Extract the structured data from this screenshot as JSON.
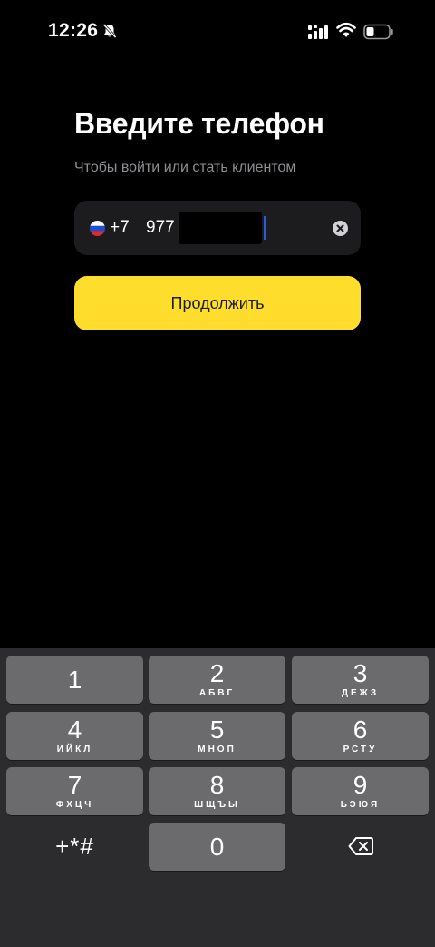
{
  "status_bar": {
    "time": "12:26",
    "icons": [
      "bell-slash-icon",
      "cellular-signal-icon",
      "wifi-icon",
      "battery-icon"
    ]
  },
  "login": {
    "title": "Введите телефон",
    "subtitle": "Чтобы войти или стать клиентом",
    "phone": {
      "country_flag": "russia-flag-icon",
      "country_code": "+7",
      "value": "977 7"
    },
    "continue_label": "Продолжить"
  },
  "colors": {
    "accent": "#ffdd2d",
    "background": "#000000",
    "field_background": "#1c1c1e",
    "keypad_background": "#2c2c2e",
    "key_background": "#6b6b6d",
    "caret": "#2a5bd7"
  },
  "keypad": {
    "keys": [
      {
        "digit": "1",
        "letters": ""
      },
      {
        "digit": "2",
        "letters": "АБВГ"
      },
      {
        "digit": "3",
        "letters": "ДЕЖЗ"
      },
      {
        "digit": "4",
        "letters": "ИЙКЛ"
      },
      {
        "digit": "5",
        "letters": "МНОП"
      },
      {
        "digit": "6",
        "letters": "РСТУ"
      },
      {
        "digit": "7",
        "letters": "ФХЦЧ"
      },
      {
        "digit": "8",
        "letters": "ШЩЪЫ"
      },
      {
        "digit": "9",
        "letters": "ЬЭЮЯ"
      },
      {
        "digit": "0",
        "letters": ""
      }
    ],
    "symbols_label": "+*#",
    "delete_icon": "delete-backspace-icon"
  }
}
